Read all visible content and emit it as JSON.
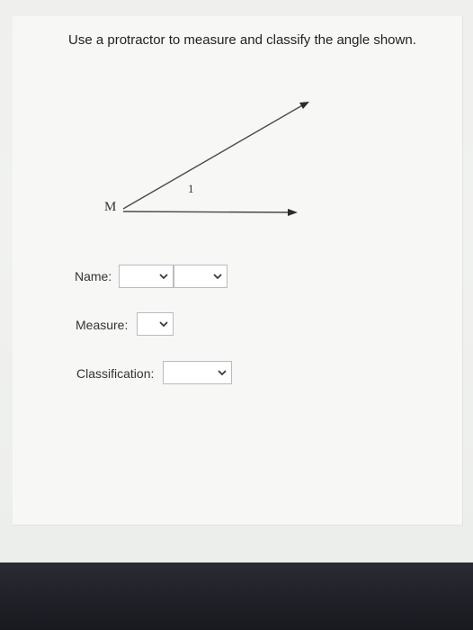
{
  "question": {
    "prompt": "Use a protractor to measure and classify the angle shown."
  },
  "diagram": {
    "vertex_label": "M",
    "angle_label": "1"
  },
  "fields": {
    "name_label": "Name:",
    "measure_label": "Measure:",
    "classification_label": "Classification:"
  },
  "icons": {
    "dropdown": "chevron-down-icon"
  },
  "colors": {
    "text": "#222222",
    "select_border": "#b9bcbf",
    "chevron": "#3a3a3a"
  }
}
